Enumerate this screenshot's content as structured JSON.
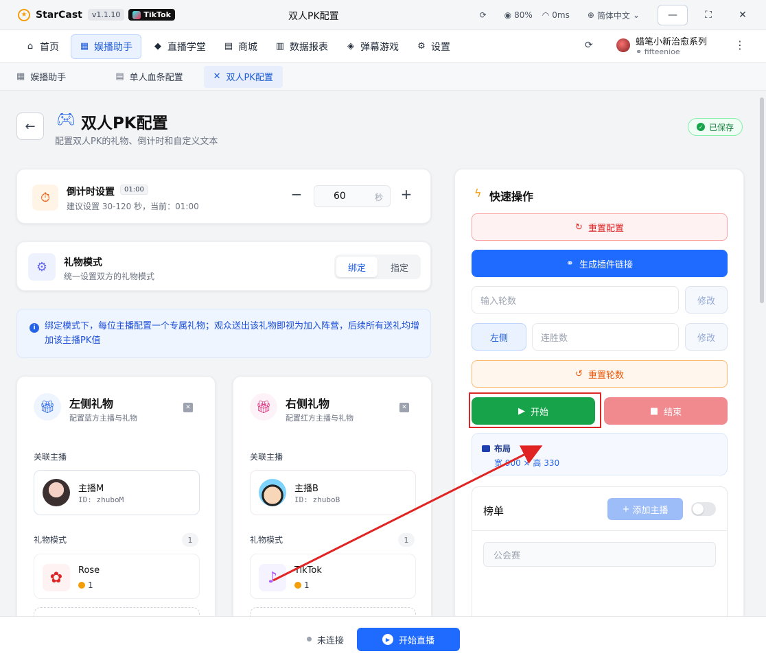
{
  "titlebar": {
    "app_name": "StarCast",
    "version": "v1.1.10",
    "platform": "TikTok",
    "window_title": "双人PK配置",
    "cpu": "80%",
    "latency": "0ms",
    "language": "简体中文"
  },
  "nav": {
    "items": [
      {
        "label": "首页",
        "icon": "home-icon"
      },
      {
        "label": "娱播助手",
        "icon": "grid-icon"
      },
      {
        "label": "直播学堂",
        "icon": "graduation-cap-icon"
      },
      {
        "label": "商城",
        "icon": "store-icon"
      },
      {
        "label": "数据报表",
        "icon": "chart-icon"
      },
      {
        "label": "弹幕游戏",
        "icon": "gamepad-icon"
      },
      {
        "label": "设置",
        "icon": "gear-icon"
      }
    ],
    "user_name": "蜡笔小新治愈系列",
    "user_id": "fifteenioe"
  },
  "tabs": [
    {
      "label": "娱播助手"
    },
    {
      "label": "单人血条配置"
    },
    {
      "label": "双人PK配置"
    }
  ],
  "page": {
    "title": "双人PK配置",
    "subtitle": "配置双人PK的礼物、倒计时和自定义文本",
    "saved": "已保存"
  },
  "timer": {
    "title": "倒计时设置",
    "badge": "01:00",
    "hint": "建议设置 30-120 秒，当前：01:00",
    "value": "60",
    "unit": "秒"
  },
  "gift_mode": {
    "title": "礼物模式",
    "desc": "统一设置双方的礼物模式",
    "option_a": "绑定",
    "option_b": "指定"
  },
  "info": {
    "text": "绑定模式下，每位主播配置一个专属礼物；观众送出该礼物即视为加入阵营，后续所有送礼均增加该主播PK值"
  },
  "left_gift": {
    "title": "左侧礼物",
    "sub": "配置蓝方主播与礼物",
    "streamer_label": "关联主播",
    "streamer_name": "主播M",
    "streamer_id": "ID: zhuboM",
    "mode_label": "礼物模式",
    "count": "1",
    "gift_name": "Rose",
    "gift_coin": "1"
  },
  "right_gift": {
    "title": "右侧礼物",
    "sub": "配置红方主播与礼物",
    "streamer_label": "关联主播",
    "streamer_name": "主播B",
    "streamer_id": "ID: zhuboB",
    "mode_label": "礼物模式",
    "count": "1",
    "gift_name": "TikTok",
    "gift_coin": "1"
  },
  "quick": {
    "title": "快速操作",
    "reset_config": "重置配置",
    "gen_link": "生成插件链接",
    "rounds_placeholder": "输入轮数",
    "modify": "修改",
    "left_side": "左侧",
    "wins_placeholder": "连胜数",
    "reset_rounds": "重置轮数",
    "start": "开始",
    "end": "结束",
    "layout_title": "布局",
    "layout_value": "宽 900 × 高 330",
    "rank_title": "榜单",
    "add_streamer": "添加主播",
    "rank_placeholder": "公会赛"
  },
  "bottom": {
    "status": "未连接",
    "start_live": "开始直播"
  },
  "colors": {
    "primary": "#1f6bff",
    "success": "#16a34a",
    "danger": "#dc2626",
    "annotation": "#e02424"
  }
}
